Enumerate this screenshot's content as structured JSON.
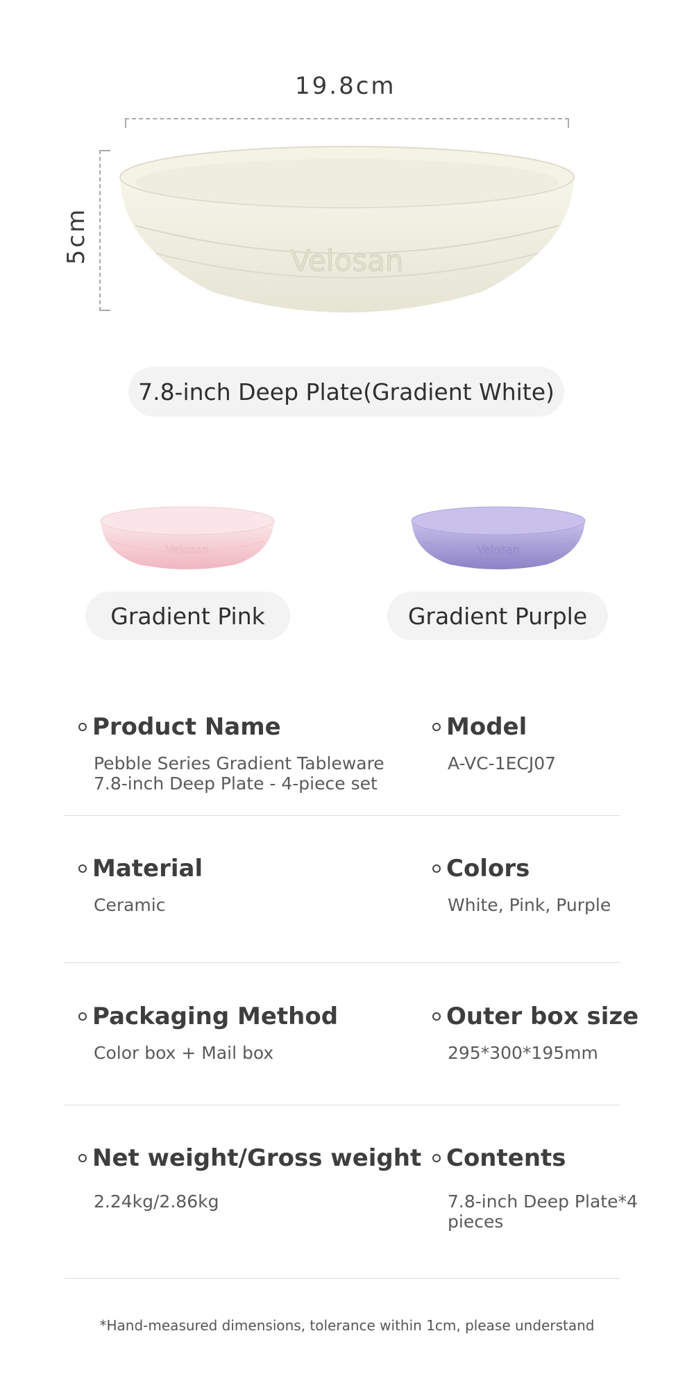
{
  "dimensions": {
    "width": "19.8cm",
    "height": "5cm"
  },
  "plates": {
    "main": {
      "label": "7.8-inch Deep Plate(Gradient White)",
      "brand_emboss": "Velosan",
      "color": "#efeedf"
    },
    "pink": {
      "label": "Gradient Pink",
      "brand_emboss": "Velosan",
      "color": "#f3c8cf"
    },
    "purple": {
      "label": "Gradient Purple",
      "brand_emboss": "Velosan",
      "color": "#9a8fce"
    }
  },
  "specs": [
    {
      "label": "Product Name",
      "value": "Pebble Series Gradient Tableware\n7.8-inch Deep Plate - 4-piece set"
    },
    {
      "label": "Model",
      "value": "A-VC-1ECJ07"
    },
    {
      "label": "Material",
      "value": "Ceramic"
    },
    {
      "label": "Colors",
      "value": "White, Pink, Purple"
    },
    {
      "label": "Packaging Method",
      "value": "Color box + Mail box"
    },
    {
      "label": "Outer box size",
      "value": "295*300*195mm"
    },
    {
      "label": "Net weight/Gross weight",
      "value": "2.24kg/2.86kg"
    },
    {
      "label": "Contents",
      "value": "7.8-inch Deep Plate*4\npieces"
    }
  ],
  "footnote": "*Hand-measured dimensions, tolerance within 1cm, please understand"
}
